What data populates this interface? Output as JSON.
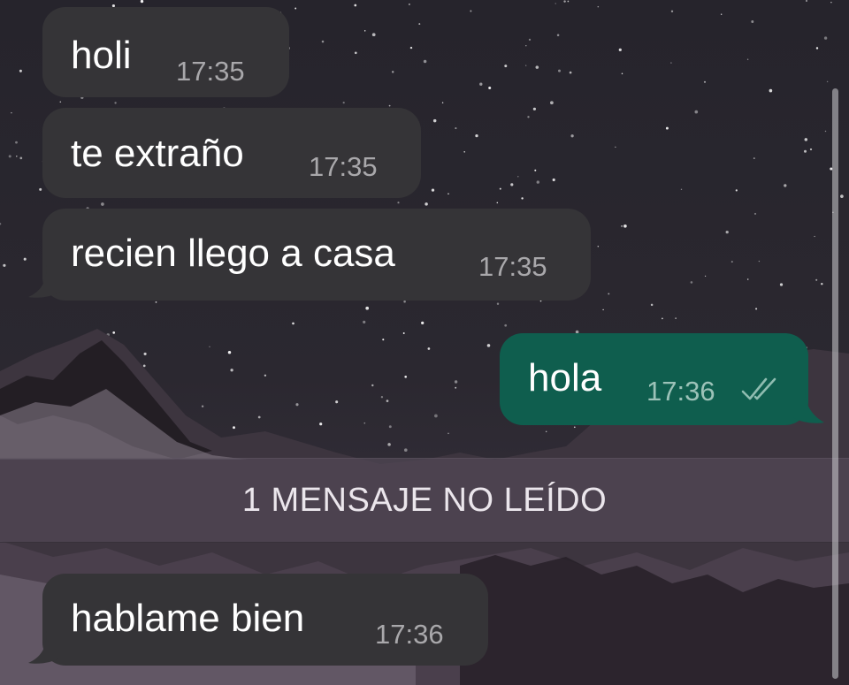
{
  "messages": [
    {
      "text": "holi",
      "time": "17:35",
      "direction": "incoming"
    },
    {
      "text": "te extraño",
      "time": "17:35",
      "direction": "incoming"
    },
    {
      "text": "recien llego a casa",
      "time": "17:35",
      "direction": "incoming"
    },
    {
      "text": "hola",
      "time": "17:36",
      "direction": "outgoing",
      "status_icon": "double-check-icon"
    }
  ],
  "unread_divider": "1 MENSAJE NO LEÍDO",
  "new_messages": [
    {
      "text": "hablame bien",
      "time": "17:36",
      "direction": "incoming"
    }
  ],
  "colors": {
    "incoming_bubble": "#353437",
    "outgoing_bubble": "#0f5e4e",
    "unread_bar": "#524856"
  }
}
